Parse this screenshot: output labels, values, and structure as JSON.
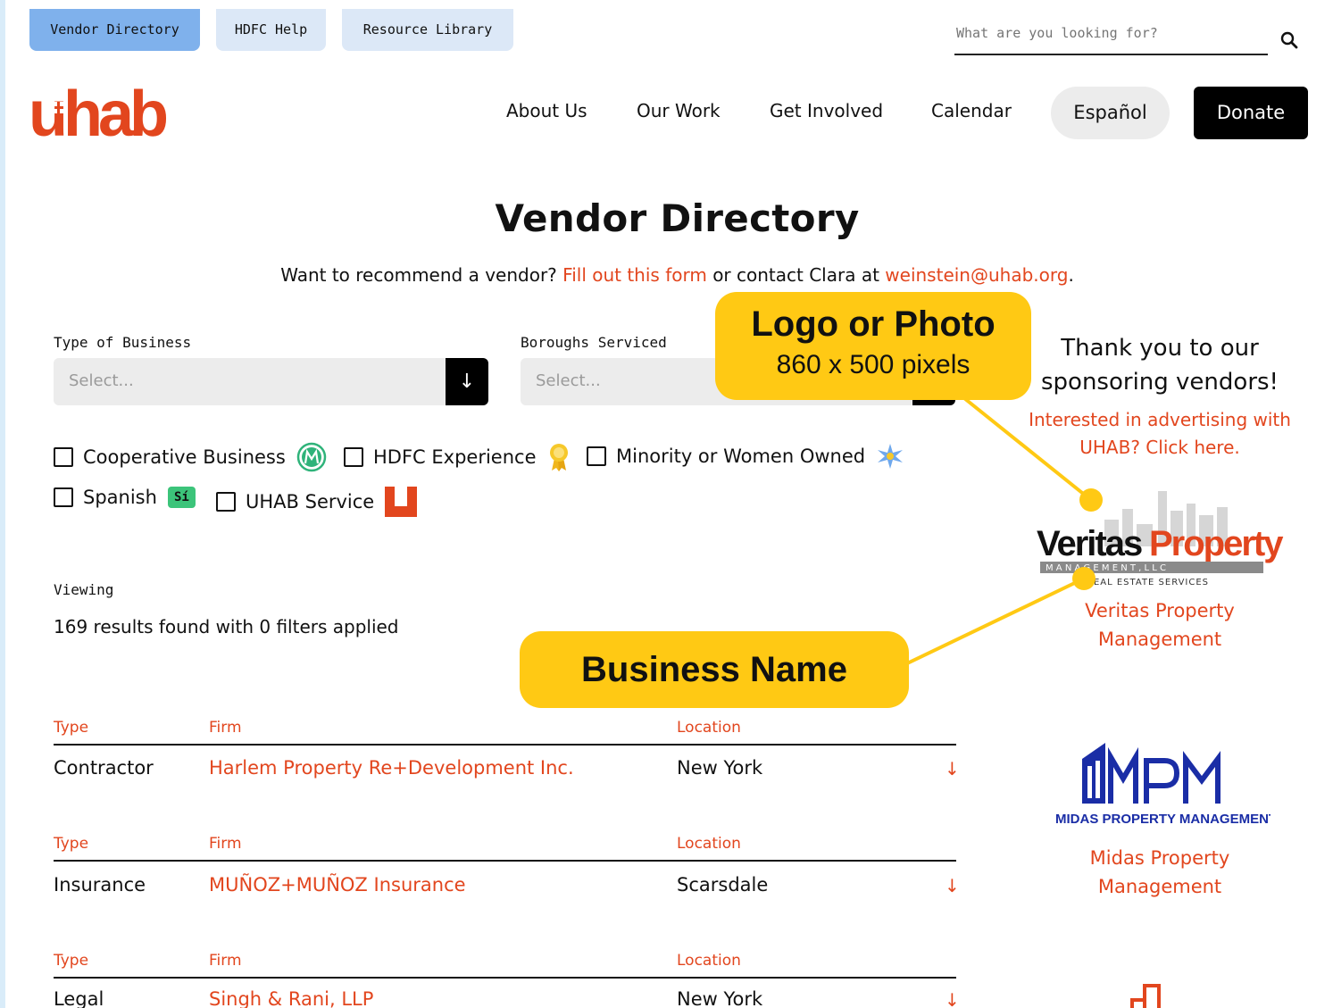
{
  "utility_tabs": [
    {
      "label": "Vendor Directory",
      "active": true
    },
    {
      "label": "HDFC Help",
      "active": false
    },
    {
      "label": "Resource Library",
      "active": false
    }
  ],
  "search": {
    "placeholder": "What are you looking for?"
  },
  "logo": {
    "text": "uhab",
    "color": "#e2461e"
  },
  "nav": {
    "items": [
      "About Us",
      "Our Work",
      "Get Involved",
      "Calendar"
    ],
    "language": "Español",
    "donate": "Donate"
  },
  "page": {
    "title": "Vendor Directory",
    "subtitle_prefix": "Want to recommend a vendor?",
    "form_link": "Fill out this form",
    "subtitle_middle": "or contact Clara at",
    "email": "weinstein@uhab.org",
    "subtitle_suffix": "."
  },
  "filters": {
    "type_label": "Type of Business",
    "type_placeholder": "Select...",
    "boroughs_label": "Boroughs Serviced",
    "boroughs_placeholder": "Select...",
    "checkboxes": [
      {
        "label": "Cooperative Business",
        "icon": "cooperative-icon",
        "checked": false
      },
      {
        "label": "HDFC Experience",
        "icon": "award-ribbon-icon",
        "checked": false
      },
      {
        "label": "Minority or Women Owned",
        "icon": "star-icon",
        "checked": false
      },
      {
        "label": "Spanish",
        "icon": "spanish-si-badge",
        "badge_text": "Sí",
        "checked": false
      },
      {
        "label": "UHAB Service",
        "icon": "uhab-u-icon",
        "checked": false
      }
    ]
  },
  "results": {
    "viewing_label": "Viewing",
    "summary": "169 results found with 0 filters applied"
  },
  "table": {
    "headers": {
      "type": "Type",
      "firm": "Firm",
      "location": "Location"
    },
    "rows": [
      {
        "type": "Contractor",
        "firm": "Harlem Property Re+Development Inc.",
        "location": "New York",
        "arrow": "↓"
      },
      {
        "type": "Insurance",
        "firm": "MUÑOZ+MUÑOZ Insurance",
        "location": "Scarsdale",
        "arrow": "↓"
      },
      {
        "type": "Legal",
        "firm": "Singh & Rani, LLP",
        "location": "New York",
        "arrow": "↓"
      }
    ]
  },
  "sidebar": {
    "title": "Thank you to our sponsoring vendors!",
    "ad_link": "Interested in advertising with UHAB? Click here.",
    "sponsors": [
      {
        "name": "Veritas Property Management",
        "logo_text_a": "Veritas",
        "logo_text_b": "Property",
        "logo_sub": "M A N A G E M E N T ,  L L C",
        "logo_tag": "REAL ESTATE SERVICES"
      },
      {
        "name": "Midas Property Management",
        "logo_text": "MPM",
        "logo_sub": "MIDAS PROPERTY MANAGEMENT"
      }
    ]
  },
  "annotations": {
    "logo_callout_title": "Logo or Photo",
    "logo_callout_sub": "860 x 500 pixels",
    "name_callout": "Business Name",
    "color": "#ffc914"
  }
}
